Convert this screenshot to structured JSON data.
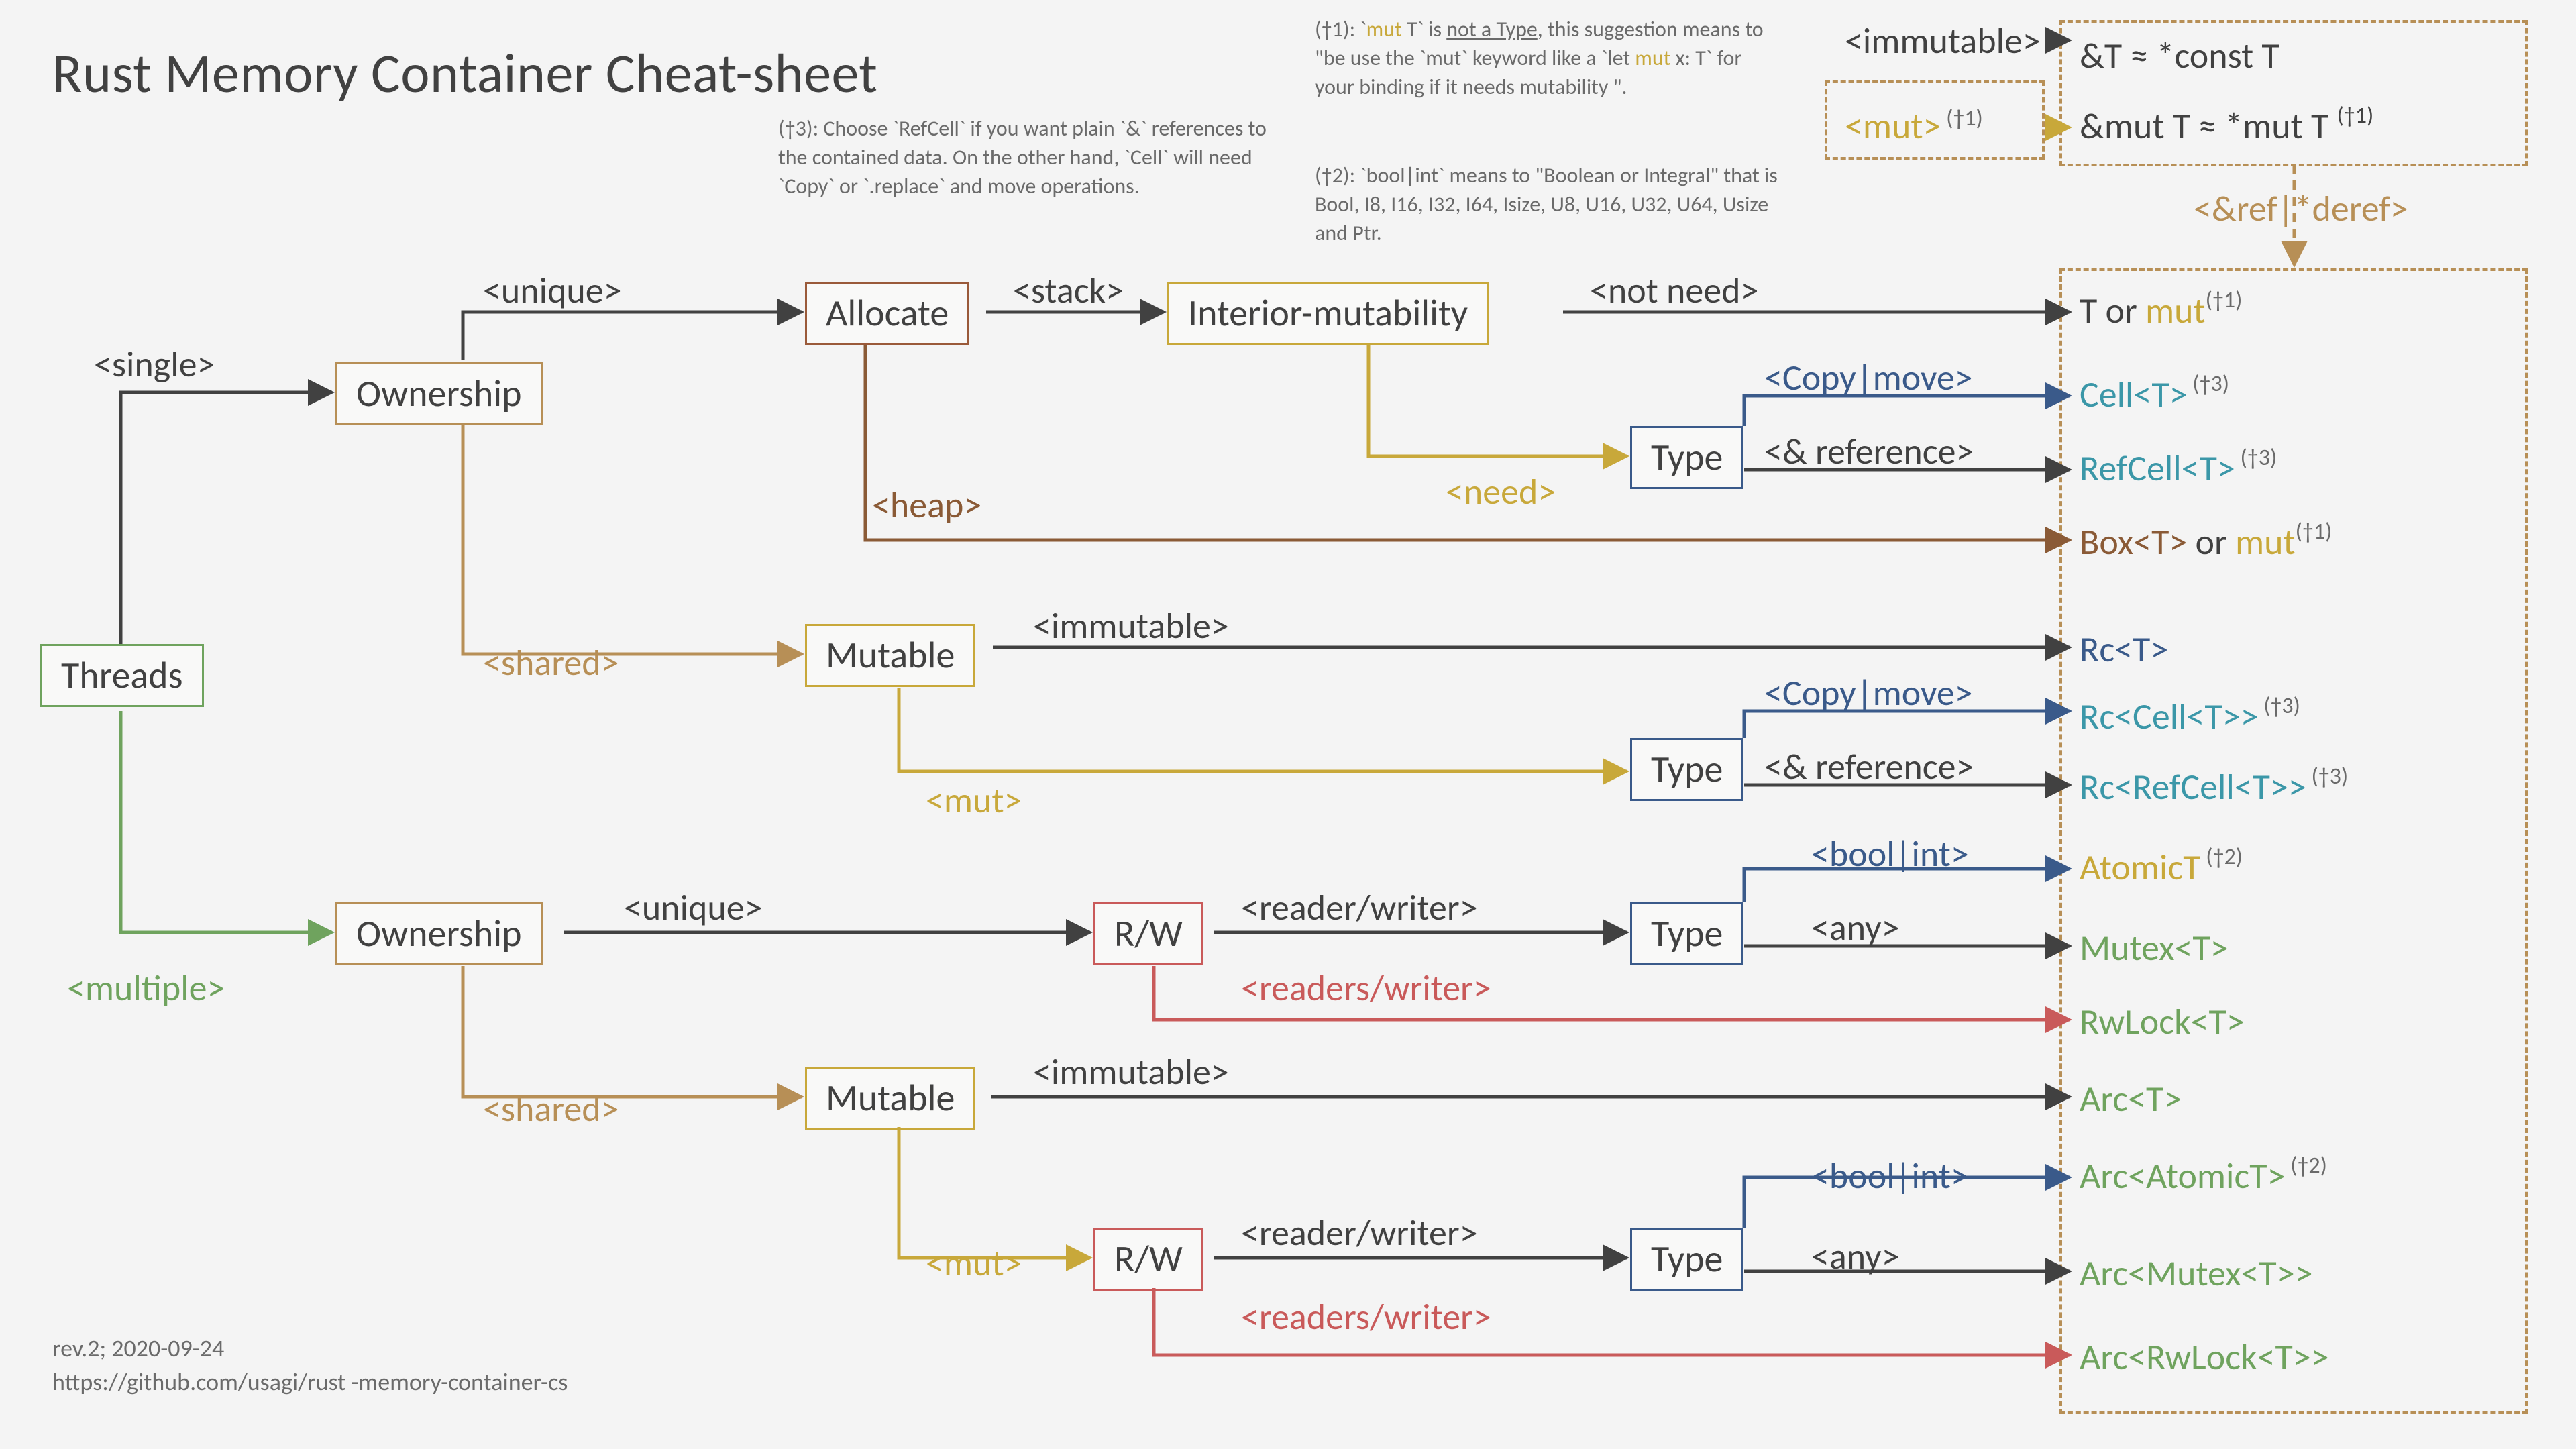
{
  "title": "Rust Memory Container Cheat-sheet",
  "footer": {
    "rev": "rev.2; 2020-09-24",
    "url": "https://github.com/usagi/rust -memory-container-cs"
  },
  "footnotes": {
    "f1_a": "(†1): `",
    "f1_b": "mut",
    "f1_c": " T` is ",
    "f1_d": "not a Type",
    "f1_e": ", this suggestion means to \"be use the `mut` keyword like a `let ",
    "f1_f": "mut",
    "f1_g": " x: T` for your binding if it needs mutability \".",
    "f2": "(†2): `bool|int` means to \"Boolean or Integral\" that is Bool, I8, I16, I32, I64, Isize, U8, U16, U32, U64,  Usize and Ptr.",
    "f3": "(†3): Choose `RefCell` if you want plain `&` references to the contained data. On the other hand, `Cell` will need `Copy` or `.replace` and move operations."
  },
  "nodes": {
    "threads": "Threads",
    "ownership": "Ownership",
    "allocate": "Allocate",
    "mutable": "Mutable",
    "interior": "Interior-mutability",
    "type": "Type",
    "rw": "R/W"
  },
  "labels": {
    "single": "<single>",
    "multiple": "<multiple>",
    "unique": "<unique>",
    "shared": "<shared>",
    "stack": "<stack>",
    "heap": "<heap>",
    "notneed": "<not need>",
    "need": "<need>",
    "immutable": "<immutable>",
    "mut": "<mut>",
    "copymove": "<Copy|move>",
    "ampref": "<& reference>",
    "boolint": "<bool|int>",
    "any": "<any>",
    "readerwriter": "<reader/writer>",
    "readerswriter": "<readers/writer>",
    "refderef": "<&ref|*deref>"
  },
  "results": {
    "refT": "&T ≈ *const T",
    "refmutT_a": "&mut T ≈ *mut T ",
    "refmutT_sup": "(†1)",
    "TorMut_a": "T",
    "TorMut_or": " or ",
    "TorMut_b": "mut",
    "TorMut_sup": "(†1)",
    "cell": "Cell<T>",
    "cell_sup": "(†3)",
    "refcell": "RefCell<T>",
    "refcell_sup": "(†3)",
    "box_a": "Box<T>",
    "box_or": " or ",
    "box_b": "mut",
    "box_sup": "(†1)",
    "rc": "Rc<T>",
    "rccell": "Rc<Cell<T>>",
    "rccell_sup": "(†3)",
    "rcrefcell": "Rc<RefCell<T>>",
    "rcrefcell_sup": "(†3)",
    "atomict": "AtomicT",
    "atomict_sup": "(†2)",
    "mutex": "Mutex<T>",
    "rwlock": "RwLock<T>",
    "arc": "Arc<T>",
    "arcatomic": "Arc<AtomicT>",
    "arcatomic_sup": "(†2)",
    "arcmutex": "Arc<Mutex<T>>",
    "arcrwlock": "Arc<RwLock<T>>"
  },
  "colors": {
    "green": "#6fa35e",
    "brown": "#b78f56",
    "darkbrown": "#8a5a36",
    "yellow": "#c8a83a",
    "blue": "#3a5a8a",
    "teal": "#3b97a8",
    "red": "#c95a5a",
    "text": "#414141"
  }
}
